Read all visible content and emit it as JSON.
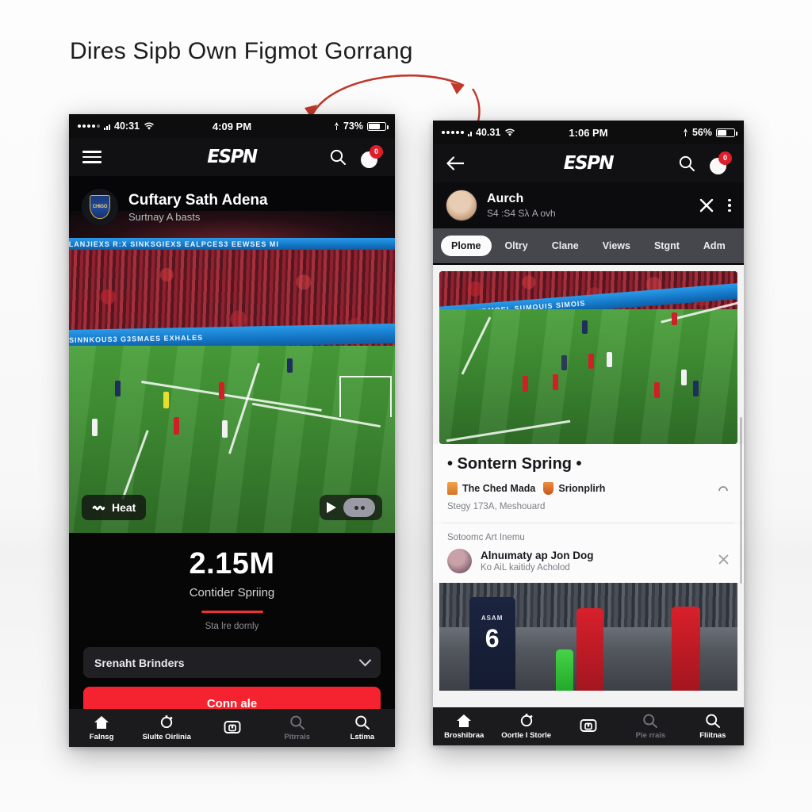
{
  "page": {
    "heading": "Dires Sipb Own Figmot Gorrang",
    "accent_red": "#f5232f",
    "background": "#f7f7f7"
  },
  "connector": {
    "name": "double-headed-curved-arrow",
    "color": "#c0392b"
  },
  "left_phone": {
    "status_bar": {
      "carrier": "40:31",
      "time": "4:09 PM",
      "battery": "73%",
      "wifi_icon": "wifi-icon",
      "signal_icon": "signal-dots-icon",
      "location_icon": "location-arrow-icon"
    },
    "nav": {
      "menu_icon": "hamburger-menu-icon",
      "logo": "ESPN",
      "search_icon": "search-icon",
      "avatar_icon": "avatar-icon",
      "badge_count": "0"
    },
    "event_header": {
      "title": "Cuftary Sath Adena",
      "subtitle": "Surtnay A basts",
      "crest_text": "CHIGO"
    },
    "video": {
      "led_text": "SINNKOUS3   G3SMAES   EXHALES",
      "led_top_text": "LANJIEXS  R:X   SINKSGIEXS   EALPCES3   EEWSES   MI",
      "heat_label": "Heat",
      "heat_icon": "heat-flame-icon",
      "play_icon": "play-icon",
      "toggle_icon": "more-toggle-icon"
    },
    "stat": {
      "number": "2.15M",
      "label": "Contider Spriing",
      "note": "Sta lre dornly"
    },
    "form": {
      "dropdown_value": "Srenaht Brinders",
      "dropdown_icon": "chevron-down-icon",
      "cta_label": "Conn ale"
    },
    "tabs": [
      {
        "label": "Falnsg",
        "icon": "home-icon",
        "active": true
      },
      {
        "label": "Slulte Oirlinia",
        "icon": "scores-gear-icon",
        "active": true
      },
      {
        "label": "",
        "icon": "watch-box-icon",
        "active": true
      },
      {
        "label": "Pitrrais",
        "icon": "search-icon",
        "active": false
      },
      {
        "label": "Lstima",
        "icon": "search-icon",
        "active": true
      }
    ]
  },
  "right_phone": {
    "status_bar": {
      "carrier": "40.31",
      "time": "1:06 PM",
      "battery": "56%",
      "wifi_icon": "wifi-icon",
      "signal_icon": "signal-dots-icon",
      "location_icon": "location-arrow-icon"
    },
    "nav": {
      "back_icon": "back-arrow-icon",
      "logo": "ESPN",
      "search_icon": "search-icon",
      "avatar_icon": "avatar-icon",
      "badge_count": "0"
    },
    "account": {
      "name": "Aurch",
      "detail": "S4 :S4 Sλ A ovh",
      "close_icon": "close-icon",
      "menu_icon": "kebab-menu-icon"
    },
    "pill_tabs": [
      {
        "label": "Plome",
        "active": true
      },
      {
        "label": "Oltry",
        "active": false
      },
      {
        "label": "Clane",
        "active": false
      },
      {
        "label": "Views",
        "active": false
      },
      {
        "label": "Stgnt",
        "active": false
      },
      {
        "label": "Adm",
        "active": false
      }
    ],
    "video": {
      "led_text": "VOILS   SHIDMOEL   SUMOUIS   SIMOIS"
    },
    "section": {
      "title": "• Sontern Spring •",
      "meta_primary": "The Ched Mada",
      "meta_secondary": "Srionplirh",
      "meta_primary_icon": "book-icon",
      "meta_secondary_icon": "shield-icon",
      "arch_icon": "arch-refresh-icon",
      "sub_note": "Stegy 173A, Meshouard"
    },
    "list": {
      "label": "Sotoomc  Art Inemu",
      "item_title": "Alnuımaty ap Jon Dog",
      "item_sub": "Ko AiL kaitidy Acholod",
      "dismiss_icon": "close-icon"
    },
    "photo": {
      "jersey_name": "ASAM",
      "jersey_number": "6"
    },
    "tabs": [
      {
        "label": "Broshibraa",
        "icon": "home-icon",
        "active": true
      },
      {
        "label": "Oortle I Storle",
        "icon": "scores-gear-icon",
        "active": true
      },
      {
        "label": "",
        "icon": "watch-box-icon",
        "active": true
      },
      {
        "label": "Pie rrais",
        "icon": "search-icon",
        "active": false
      },
      {
        "label": "Fliitnas",
        "icon": "search-icon",
        "active": true
      }
    ]
  }
}
